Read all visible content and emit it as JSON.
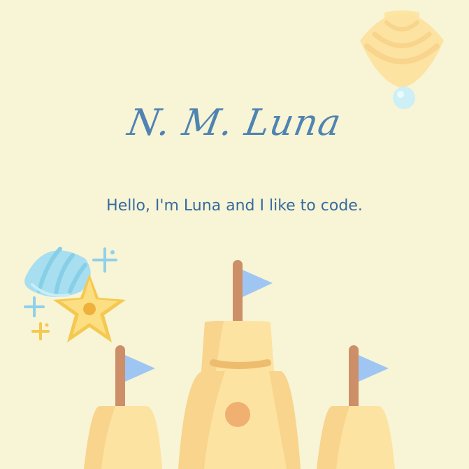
{
  "hero": {
    "title": "N. M. Luna",
    "subtitle": "Hello, I'm Luna and I like to code."
  },
  "colors": {
    "background": "#f8f4d6",
    "title": "#4f84b1",
    "subtitle": "#356b9d",
    "sand_light": "#fde3a1",
    "sand_mid": "#f8d48d",
    "sand_dark": "#eebc6f",
    "flag_blue": "#9fc6f3",
    "pole_brown": "#cc8f68",
    "seashell_blue": "#a7def0",
    "starfish_yellow": "#f5c84e"
  },
  "icons": {
    "seashell_top": "seashell-icon",
    "bubble": "bubble-icon",
    "seashell_left": "blue-seashell-icon",
    "starfish": "starfish-icon",
    "sandcastle": "sandcastle-icon"
  }
}
